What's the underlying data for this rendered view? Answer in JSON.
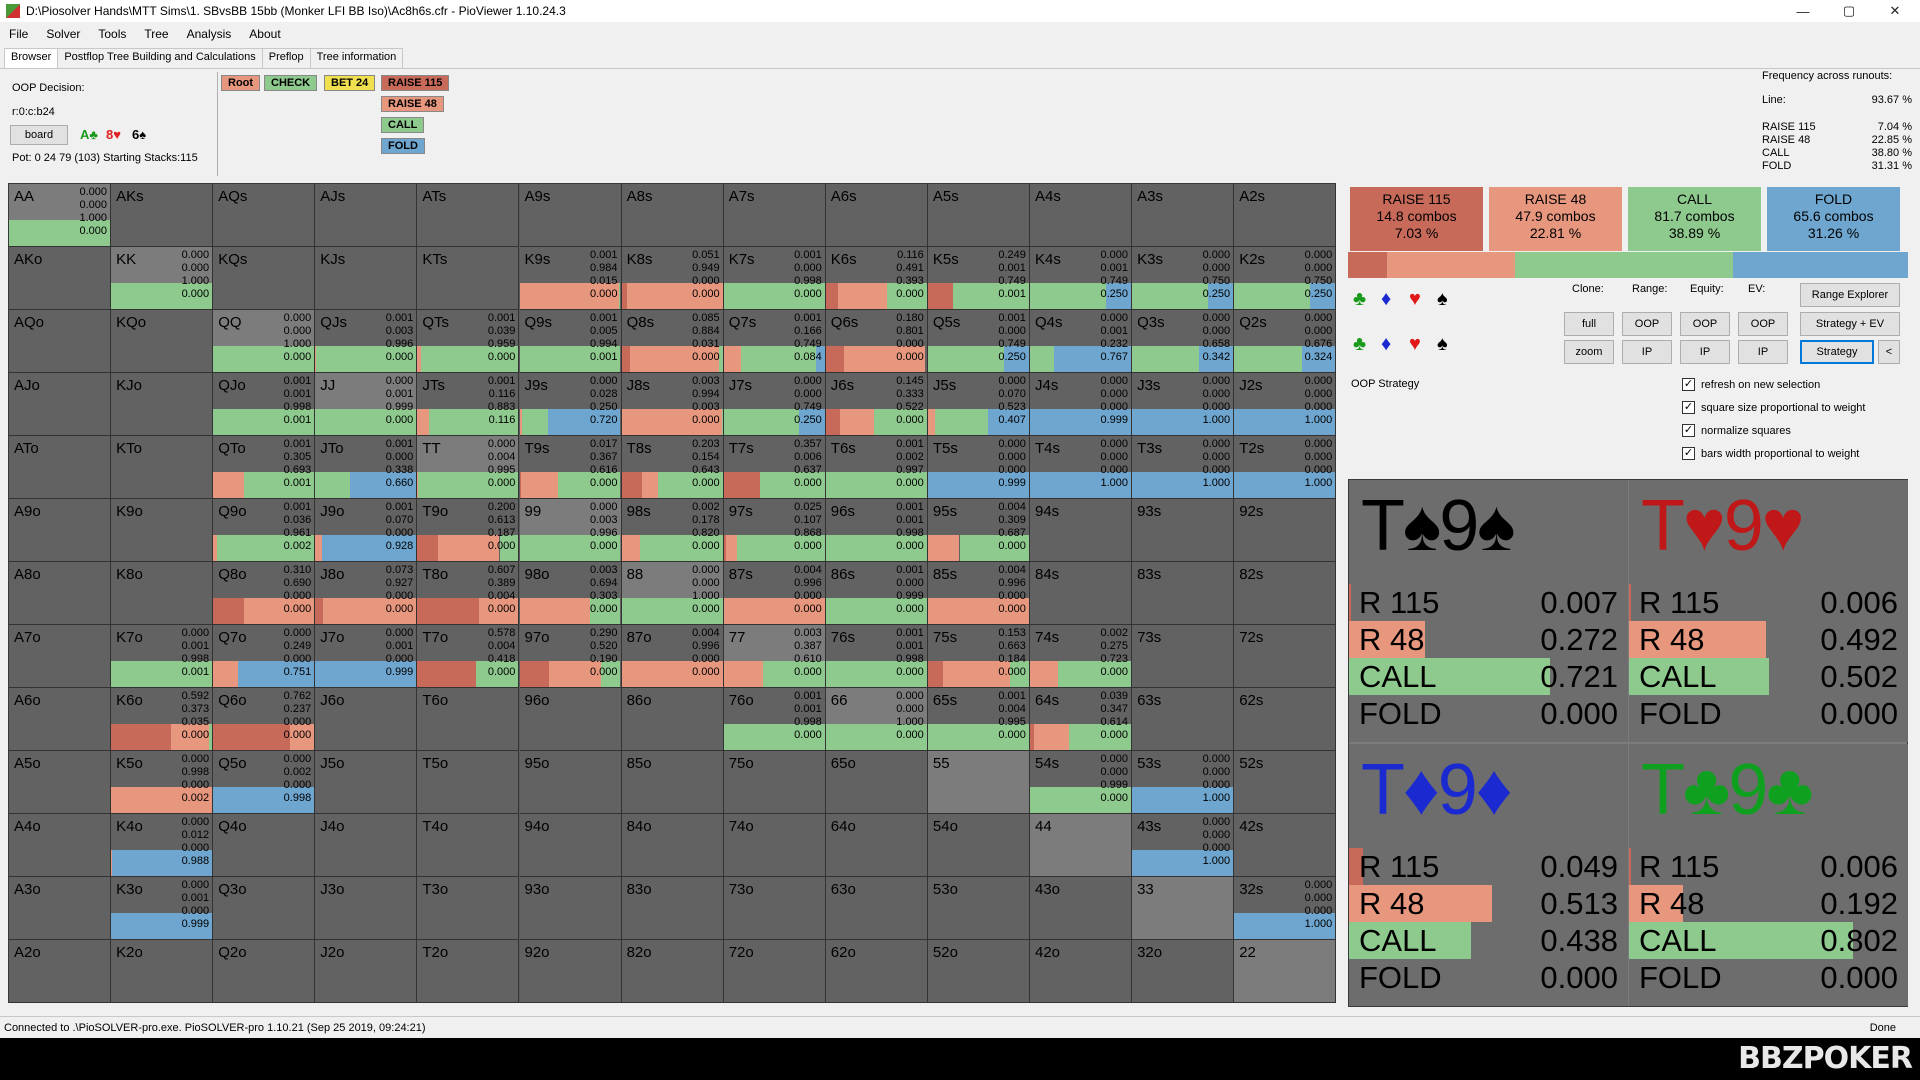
{
  "window": {
    "title": "D:\\Piosolver Hands\\MTT Sims\\1. SBvsBB 15bb (Monker LFI BB Iso)\\Ac8h6s.cfr - PioViewer 1.10.24.3",
    "min": "—",
    "max": "▢",
    "close": "✕"
  },
  "menu": [
    "File",
    "Solver",
    "Tools",
    "Tree",
    "Analysis",
    "About"
  ],
  "tabs": [
    "Browser",
    "Postflop Tree Building and Calculations",
    "Preflop",
    "Tree information"
  ],
  "info": {
    "decision": "OOP Decision:",
    "line": "r:0:c:b24",
    "board_btn": "board",
    "pot": "Pot: 0 24 79 (103) Starting Stacks:115"
  },
  "board": [
    {
      "t": "A♣",
      "c": "#1a9a1a"
    },
    {
      "t": "8♥",
      "c": "#e02020"
    },
    {
      "t": "6♠",
      "c": "#000000"
    }
  ],
  "tree": {
    "root": "Root",
    "check": "CHECK",
    "bet": "BET 24",
    "raise115": "RAISE 115",
    "raise48": "RAISE 48",
    "call": "CALL",
    "fold": "FOLD"
  },
  "freq": {
    "header": "Frequency across runouts:",
    "rows": [
      [
        "Line:",
        "93.67 %"
      ],
      [
        "RAISE 115",
        "7.04 %"
      ],
      [
        "RAISE 48",
        "22.85 %"
      ],
      [
        "CALL",
        "38.80 %"
      ],
      [
        "FOLD",
        "31.31 %"
      ]
    ]
  },
  "colors": {
    "raise115": "#c76a5a",
    "raise48": "#e8977f",
    "call": "#8ec98e",
    "fold": "#6ea6cf",
    "pair": "#7c7c7c",
    "offsuit": "#626262"
  },
  "grid": [
    [
      "AA",
      "0.000|0.000|1.000|0.000"
    ],
    [
      "AKs",
      ""
    ],
    [
      "AQs",
      ""
    ],
    [
      "AJs",
      ""
    ],
    [
      "ATs",
      ""
    ],
    [
      "A9s",
      ""
    ],
    [
      "A8s",
      ""
    ],
    [
      "A7s",
      ""
    ],
    [
      "A6s",
      ""
    ],
    [
      "A5s",
      ""
    ],
    [
      "A4s",
      ""
    ],
    [
      "A3s",
      ""
    ],
    [
      "A2s",
      ""
    ],
    [
      "AKo",
      ""
    ],
    [
      "KK",
      "0.000|0.000|1.000|0.000"
    ],
    [
      "KQs",
      ""
    ],
    [
      "KJs",
      ""
    ],
    [
      "KTs",
      ""
    ],
    [
      "K9s",
      "0.001|0.984|0.015|0.000"
    ],
    [
      "K8s",
      "0.051|0.949|0.000|0.000"
    ],
    [
      "K7s",
      "0.001|0.000|0.998|0.000"
    ],
    [
      "K6s",
      "0.116|0.491|0.393|0.000"
    ],
    [
      "K5s",
      "0.249|0.001|0.749|0.001"
    ],
    [
      "K4s",
      "0.000|0.001|0.749|0.250"
    ],
    [
      "K3s",
      "0.000|0.000|0.750|0.250"
    ],
    [
      "K2s",
      "0.000|0.000|0.750|0.250"
    ],
    [
      "AQo",
      ""
    ],
    [
      "KQo",
      ""
    ],
    [
      "QQ",
      "0.000|0.000|1.000|0.000"
    ],
    [
      "QJs",
      "0.001|0.003|0.996|0.000"
    ],
    [
      "QTs",
      "0.001|0.039|0.959|0.000"
    ],
    [
      "Q9s",
      "0.001|0.005|0.994|0.001"
    ],
    [
      "Q8s",
      "0.085|0.884|0.031|0.000"
    ],
    [
      "Q7s",
      "0.001|0.166|0.749|0.084"
    ],
    [
      "Q6s",
      "0.180|0.801|0.000|0.000"
    ],
    [
      "Q5s",
      "0.001|0.000|0.749|0.250"
    ],
    [
      "Q4s",
      "0.000|0.001|0.232|0.767"
    ],
    [
      "Q3s",
      "0.000|0.000|0.658|0.342"
    ],
    [
      "Q2s",
      "0.000|0.000|0.676|0.324"
    ],
    [
      "AJo",
      ""
    ],
    [
      "KJo",
      ""
    ],
    [
      "QJo",
      "0.001|0.001|0.998|0.001"
    ],
    [
      "JJ",
      "0.000|0.001|0.999|0.000"
    ],
    [
      "JTs",
      "0.001|0.116|0.883|0.116"
    ],
    [
      "J9s",
      "0.000|0.028|0.250|0.720"
    ],
    [
      "J8s",
      "0.003|0.994|0.003|0.000"
    ],
    [
      "J7s",
      "0.000|0.000|0.749|0.250"
    ],
    [
      "J6s",
      "0.145|0.333|0.522|0.000"
    ],
    [
      "J5s",
      "0.000|0.070|0.523|0.407"
    ],
    [
      "J4s",
      "0.000|0.000|0.000|0.999"
    ],
    [
      "J3s",
      "0.000|0.000|0.000|1.000"
    ],
    [
      "J2s",
      "0.000|0.000|0.000|1.000"
    ],
    [
      "ATo",
      ""
    ],
    [
      "KTo",
      ""
    ],
    [
      "QTo",
      "0.001|0.305|0.693|0.001"
    ],
    [
      "JTo",
      "0.001|0.000|0.338|0.660"
    ],
    [
      "TT",
      "0.000|0.004|0.995|0.000"
    ],
    [
      "T9s",
      "0.017|0.367|0.616|0.000"
    ],
    [
      "T8s",
      "0.203|0.154|0.643|0.000"
    ],
    [
      "T7s",
      "0.357|0.006|0.637|0.000"
    ],
    [
      "T6s",
      "0.001|0.002|0.997|0.000"
    ],
    [
      "T5s",
      "0.000|0.000|0.000|0.999"
    ],
    [
      "T4s",
      "0.000|0.000|0.000|1.000"
    ],
    [
      "T3s",
      "0.000|0.000|0.000|1.000"
    ],
    [
      "T2s",
      "0.000|0.000|0.000|1.000"
    ],
    [
      "A9o",
      ""
    ],
    [
      "K9o",
      ""
    ],
    [
      "Q9o",
      "0.001|0.036|0.961|0.002"
    ],
    [
      "J9o",
      "0.001|0.070|0.000|0.928"
    ],
    [
      "T9o",
      "0.200|0.613|0.187|0.000"
    ],
    [
      "99",
      "0.000|0.003|0.996|0.000"
    ],
    [
      "98s",
      "0.002|0.178|0.820|0.000"
    ],
    [
      "97s",
      "0.025|0.107|0.868|0.000"
    ],
    [
      "96s",
      "0.001|0.001|0.998|0.000"
    ],
    [
      "95s",
      "0.004|0.309|0.687|0.000"
    ],
    [
      "94s",
      ""
    ],
    [
      "93s",
      ""
    ],
    [
      "92s",
      ""
    ],
    [
      "A8o",
      ""
    ],
    [
      "K8o",
      ""
    ],
    [
      "Q8o",
      "0.310|0.690|0.000|0.000"
    ],
    [
      "J8o",
      "0.073|0.927|0.000|0.000"
    ],
    [
      "T8o",
      "0.607|0.389|0.004|0.000"
    ],
    [
      "98o",
      "0.003|0.694|0.303|0.000"
    ],
    [
      "88",
      "0.000|0.000|1.000|0.000"
    ],
    [
      "87s",
      "0.004|0.996|0.000|0.000"
    ],
    [
      "86s",
      "0.001|0.000|0.999|0.000"
    ],
    [
      "85s",
      "0.004|0.996|0.000|0.000"
    ],
    [
      "84s",
      ""
    ],
    [
      "83s",
      ""
    ],
    [
      "82s",
      ""
    ],
    [
      "A7o",
      ""
    ],
    [
      "K7o",
      "0.000|0.001|0.998|0.001"
    ],
    [
      "Q7o",
      "0.000|0.249|0.000|0.751"
    ],
    [
      "J7o",
      "0.000|0.001|0.000|0.999"
    ],
    [
      "T7o",
      "0.578|0.004|0.418|0.000"
    ],
    [
      "97o",
      "0.290|0.520|0.190|0.000"
    ],
    [
      "87o",
      "0.004|0.996|0.000|0.000"
    ],
    [
      "77",
      "0.003|0.387|0.610|0.000"
    ],
    [
      "76s",
      "0.001|0.001|0.998|0.000"
    ],
    [
      "75s",
      "0.153|0.663|0.184|0.000"
    ],
    [
      "74s",
      "0.002|0.275|0.723|0.000"
    ],
    [
      "73s",
      ""
    ],
    [
      "72s",
      ""
    ],
    [
      "A6o",
      ""
    ],
    [
      "K6o",
      "0.592|0.373|0.035|0.000"
    ],
    [
      "Q6o",
      "0.762|0.237|0.000|0.000"
    ],
    [
      "J6o",
      ""
    ],
    [
      "T6o",
      ""
    ],
    [
      "96o",
      ""
    ],
    [
      "86o",
      ""
    ],
    [
      "76o",
      "0.001|0.001|0.998|0.000"
    ],
    [
      "66",
      "0.000|0.000|1.000|0.000"
    ],
    [
      "65s",
      "0.001|0.004|0.995|0.000"
    ],
    [
      "64s",
      "0.039|0.347|0.614|0.000"
    ],
    [
      "63s",
      ""
    ],
    [
      "62s",
      ""
    ],
    [
      "A5o",
      ""
    ],
    [
      "K5o",
      "0.000|0.998|0.000|0.002"
    ],
    [
      "Q5o",
      "0.000|0.002|0.000|0.998"
    ],
    [
      "J5o",
      ""
    ],
    [
      "T5o",
      ""
    ],
    [
      "95o",
      ""
    ],
    [
      "85o",
      ""
    ],
    [
      "75o",
      ""
    ],
    [
      "65o",
      ""
    ],
    [
      "55",
      ""
    ],
    [
      "54s",
      "0.000|0.000|0.999|0.000"
    ],
    [
      "53s",
      "0.000|0.000|0.000|1.000"
    ],
    [
      "52s",
      ""
    ],
    [
      "A4o",
      ""
    ],
    [
      "K4o",
      "0.000|0.012|0.000|0.988"
    ],
    [
      "Q4o",
      ""
    ],
    [
      "J4o",
      ""
    ],
    [
      "T4o",
      ""
    ],
    [
      "94o",
      ""
    ],
    [
      "84o",
      ""
    ],
    [
      "74o",
      ""
    ],
    [
      "64o",
      ""
    ],
    [
      "54o",
      ""
    ],
    [
      "44",
      ""
    ],
    [
      "43s",
      "0.000|0.000|0.000|1.000"
    ],
    [
      "42s",
      ""
    ],
    [
      "A3o",
      ""
    ],
    [
      "K3o",
      "0.000|0.001|0.000|0.999"
    ],
    [
      "Q3o",
      ""
    ],
    [
      "J3o",
      ""
    ],
    [
      "T3o",
      ""
    ],
    [
      "93o",
      ""
    ],
    [
      "83o",
      ""
    ],
    [
      "73o",
      ""
    ],
    [
      "63o",
      ""
    ],
    [
      "53o",
      ""
    ],
    [
      "43o",
      ""
    ],
    [
      "33",
      ""
    ],
    [
      "32s",
      "0.000|0.000|0.000|1.000"
    ],
    [
      "A2o",
      ""
    ],
    [
      "K2o",
      ""
    ],
    [
      "Q2o",
      ""
    ],
    [
      "J2o",
      ""
    ],
    [
      "T2o",
      ""
    ],
    [
      "92o",
      ""
    ],
    [
      "82o",
      ""
    ],
    [
      "72o",
      ""
    ],
    [
      "62o",
      ""
    ],
    [
      "52o",
      ""
    ],
    [
      "42o",
      ""
    ],
    [
      "32o",
      ""
    ],
    [
      "22",
      ""
    ]
  ],
  "summary": [
    {
      "name": "RAISE 115",
      "combos": "14.8 combos",
      "pct": "7.03 %",
      "freq": 7.03
    },
    {
      "name": "RAISE 48",
      "combos": "47.9 combos",
      "pct": "22.81 %",
      "freq": 22.81
    },
    {
      "name": "CALL",
      "combos": "81.7 combos",
      "pct": "38.89 %",
      "freq": 38.89
    },
    {
      "name": "FOLD",
      "combos": "65.6 combos",
      "pct": "31.26 %",
      "freq": 31.26
    }
  ],
  "controls": {
    "clone": "Clone:",
    "range": "Range:",
    "equity": "Equity:",
    "ev": "EV:",
    "range_explorer": "Range Explorer",
    "full": "full",
    "zoom": "zoom",
    "oop": "OOP",
    "ip": "IP",
    "strategy_ev": "Strategy + EV",
    "strategy": "Strategy",
    "back": "<",
    "oop_strategy": "OOP Strategy"
  },
  "checks": [
    "refresh on new selection",
    "square size proportional to weight",
    "normalize squares",
    "bars width proportional to weight"
  ],
  "combos": [
    {
      "title": "T♠9♠",
      "color": "#000000",
      "vals": [
        [
          "R 115",
          "0.007"
        ],
        [
          "R 48",
          "0.272"
        ],
        [
          "CALL",
          "0.721"
        ],
        [
          "FOLD",
          "0.000"
        ]
      ]
    },
    {
      "title": "T♥9♥",
      "color": "#c01818",
      "vals": [
        [
          "R 115",
          "0.006"
        ],
        [
          "R 48",
          "0.492"
        ],
        [
          "CALL",
          "0.502"
        ],
        [
          "FOLD",
          "0.000"
        ]
      ]
    },
    {
      "title": "T♦9♦",
      "color": "#1a2ad0",
      "vals": [
        [
          "R 115",
          "0.049"
        ],
        [
          "R 48",
          "0.513"
        ],
        [
          "CALL",
          "0.438"
        ],
        [
          "FOLD",
          "0.000"
        ]
      ]
    },
    {
      "title": "T♣9♣",
      "color": "#10a020",
      "vals": [
        [
          "R 115",
          "0.006"
        ],
        [
          "R 48",
          "0.192"
        ],
        [
          "CALL",
          "0.802"
        ],
        [
          "FOLD",
          "0.000"
        ]
      ]
    }
  ],
  "status": {
    "text": "Connected to .\\PioSOLVER-pro.exe. PioSOLVER-pro 1.10.21 (Sep 25 2019, 09:24:21)",
    "done": "Done"
  },
  "watermark": "BBZPOKER"
}
